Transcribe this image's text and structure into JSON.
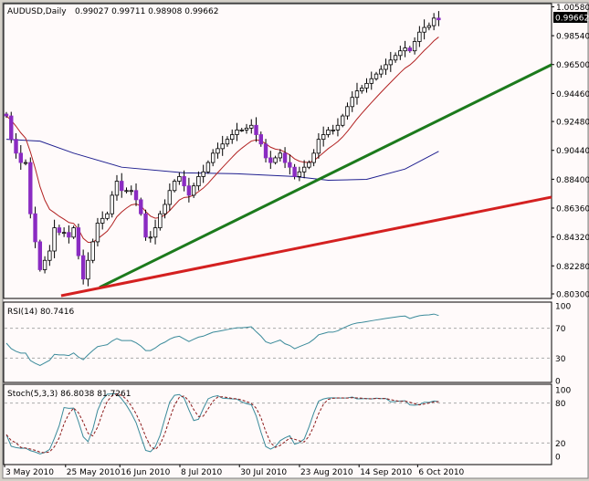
{
  "header": {
    "symbol_tf": "AUDUSD,Daily",
    "ohlc": "0.99027 0.99711 0.98908 0.99662"
  },
  "last_price_label": "0.99662",
  "colors": {
    "bg": "#fffafa",
    "bull": "#ffffff",
    "bear": "#8a2bc2",
    "ma_fast": "#b22222",
    "ma_slow": "#1f1f8f",
    "trend_green": "#1c7a1c",
    "trend_red": "#d42020",
    "osc_main": "#3a8a9a",
    "osc_signal": "#8b1a1a",
    "last_box": "#000000"
  },
  "rsi": {
    "label": "RSI(14) 80.7416",
    "levels": [
      "100",
      "70",
      "30",
      "0"
    ]
  },
  "stoch": {
    "label": "Stoch(5,3,3) 86.8038 81.7261",
    "levels": [
      "100",
      "80",
      "20",
      "0"
    ]
  },
  "chart_data": {
    "type": "candlestick",
    "title": "AUDUSD,Daily",
    "price_ticks": [
      "1.00580",
      "0.98540",
      "0.96500",
      "0.94460",
      "0.92480",
      "0.90440",
      "0.88400",
      "0.86360",
      "0.84320",
      "0.82280",
      "0.80300"
    ],
    "ylim": [
      0.803,
      1.0058
    ],
    "first_open": 0.93,
    "close": [
      0.9287,
      0.9122,
      0.9024,
      0.8958,
      0.8958,
      0.8596,
      0.8398,
      0.8201,
      0.8267,
      0.8333,
      0.8497,
      0.8464,
      0.8464,
      0.8431,
      0.8497,
      0.83,
      0.8135,
      0.8267,
      0.8398,
      0.853,
      0.8563,
      0.8596,
      0.8727,
      0.8826,
      0.876,
      0.876,
      0.876,
      0.8695,
      0.8596,
      0.8431,
      0.8431,
      0.8497,
      0.8596,
      0.8662,
      0.876,
      0.8826,
      0.8859,
      0.8793,
      0.8727,
      0.8793,
      0.8859,
      0.8892,
      0.8958,
      0.9024,
      0.9056,
      0.9089,
      0.9122,
      0.9155,
      0.9188,
      0.9188,
      0.9201,
      0.9221,
      0.9155,
      0.9089,
      0.8991,
      0.8958,
      0.8991,
      0.9024,
      0.8958,
      0.8925,
      0.8859,
      0.8892,
      0.8925,
      0.8958,
      0.9024,
      0.9122,
      0.9155,
      0.9188,
      0.9188,
      0.9221,
      0.9287,
      0.9353,
      0.9418,
      0.9464,
      0.9484,
      0.9517,
      0.955,
      0.9583,
      0.9616,
      0.9649,
      0.9682,
      0.9714,
      0.9747,
      0.9767,
      0.9747,
      0.9813,
      0.9879,
      0.9912,
      0.9925,
      0.9978,
      0.99662
    ],
    "ma_slow": [
      [
        0,
        0.9122
      ],
      [
        7,
        0.9109
      ],
      [
        14,
        0.9024
      ],
      [
        24,
        0.8925
      ],
      [
        37,
        0.8885
      ],
      [
        48,
        0.8879
      ],
      [
        60,
        0.8859
      ],
      [
        67,
        0.8833
      ],
      [
        75,
        0.8839
      ],
      [
        83,
        0.8912
      ],
      [
        90,
        0.9037
      ]
    ],
    "trendlines": [
      {
        "name": "green",
        "from": [
          19.4,
          0.8076
        ],
        "to": [
          113.9,
          0.9649
        ]
      },
      {
        "name": "red",
        "from": [
          11.4,
          0.8017
        ],
        "to": [
          113.9,
          0.8714
        ]
      }
    ],
    "date_ticks": [
      {
        "bar": 0,
        "label": "3 May 2010"
      },
      {
        "bar": 12.7,
        "label": "25 May 2010"
      },
      {
        "bar": 24,
        "label": "16 Jun 2010"
      },
      {
        "bar": 36.5,
        "label": "8 Jul 2010"
      },
      {
        "bar": 48.9,
        "label": "30 Jul 2010"
      },
      {
        "bar": 61.4,
        "label": "23 Aug 2010"
      },
      {
        "bar": 73.8,
        "label": "14 Sep 2010"
      },
      {
        "bar": 86,
        "label": "6 Oct 2010"
      }
    ]
  }
}
